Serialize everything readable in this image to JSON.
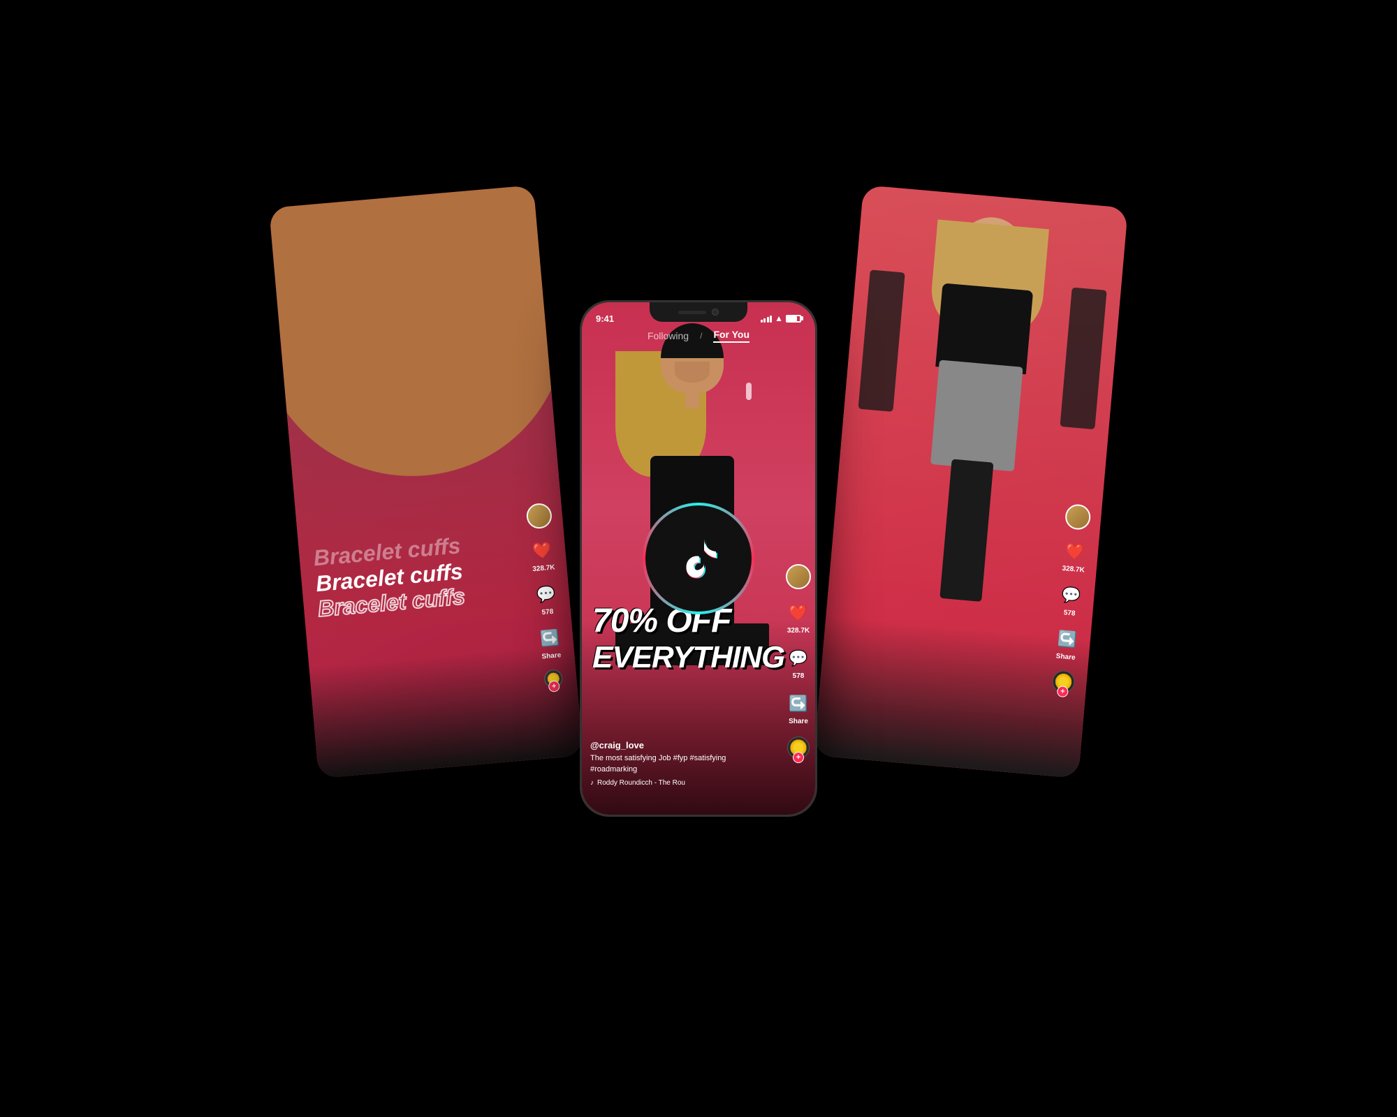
{
  "app": {
    "name": "TikTok",
    "background_color": "#000000"
  },
  "tiktok_logo": {
    "alt": "TikTok Logo"
  },
  "center_phone": {
    "status_bar": {
      "time": "9:41",
      "signal": "full",
      "wifi": true,
      "battery": "full"
    },
    "nav": {
      "following_label": "Following",
      "divider": "/",
      "for_you_label": "For You",
      "active_tab": "for_you"
    },
    "promo": {
      "line1": "70% OFF",
      "line2": "EVERYTHING"
    },
    "video_info": {
      "username": "@craig_love",
      "caption": "The most satisfying Job #fyp #satisfying #roadmarking",
      "music_note": "♪",
      "music_text": "Roddy Roundicch - The Rou"
    },
    "actions": {
      "likes": "328.7K",
      "comments": "578",
      "share_label": "Share"
    }
  },
  "left_phone": {
    "content": {
      "bracelet_line1": "Bracelet cuffs",
      "bracelet_line2": "Bracelet cuffs",
      "bracelet_line3": "Bracelet cuffs"
    },
    "actions": {
      "likes": "328.7K",
      "comments": "578",
      "share_label": "Share"
    }
  },
  "right_phone": {
    "actions": {
      "likes": "328.7K",
      "comments": "578",
      "share_label": "Share"
    }
  }
}
